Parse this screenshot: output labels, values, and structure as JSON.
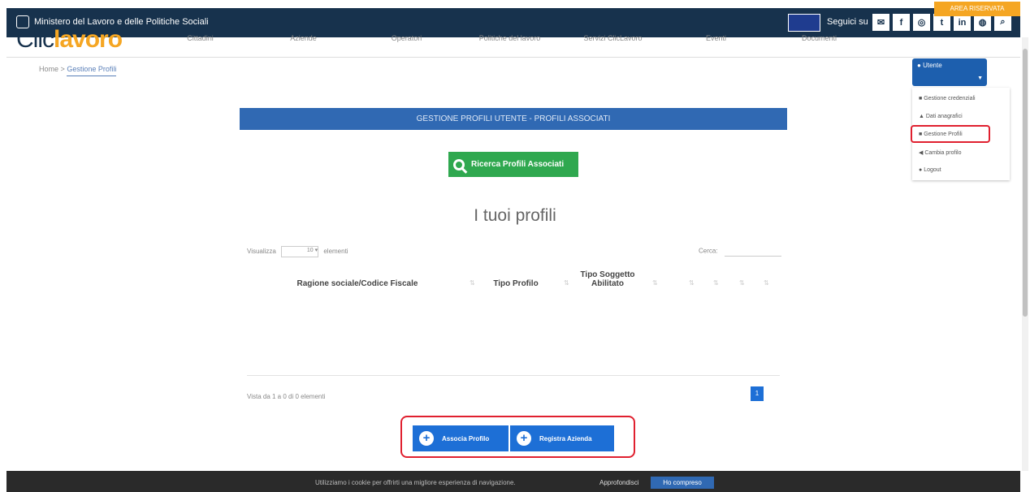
{
  "topbar": {
    "ministry": "Ministero del Lavoro e delle Politiche Sociali",
    "seguici": "Seguici su",
    "socials": [
      {
        "icon": "email-icon",
        "glyph": "✉"
      },
      {
        "icon": "facebook-icon",
        "glyph": "f"
      },
      {
        "icon": "instagram-icon",
        "glyph": "◎"
      },
      {
        "icon": "twitter-icon",
        "glyph": "t"
      },
      {
        "icon": "linkedin-icon",
        "glyph": "in"
      },
      {
        "icon": "flickr-icon",
        "glyph": "◍"
      },
      {
        "icon": "search-icon",
        "glyph": "⌕"
      }
    ]
  },
  "header": {
    "logo_main": "Clic",
    "logo_accent": "lavoro",
    "nav": [
      "Cittadini",
      "Aziende",
      "Operatori",
      "Politiche del lavoro",
      "Servizi ClicLavoro",
      "Eventi",
      "Documenti"
    ],
    "area_riservata": "AREA RISERVATA"
  },
  "breadcrumb": {
    "home": "Home",
    "separator": ">",
    "current": "Gestione Profili"
  },
  "user": {
    "name": "Utente",
    "menu": [
      "Gestione credenziali",
      "Dati anagrafici",
      "Gestione Profili",
      "Cambia profilo",
      "Logout"
    ]
  },
  "main": {
    "title": "GESTIONE PROFILI UTENTE - PROFILI ASSOCIATI",
    "search_button": "Ricerca Profili Associati",
    "profiles_title": "I tuoi profili",
    "length_label": "Visualizza",
    "length_value": "10",
    "length_suffix": "elementi",
    "filter_label": "Cerca:",
    "columns": [
      "Ragione sociale/Codice Fiscale",
      "Tipo Profilo",
      "Tipo Soggetto Abilitato"
    ],
    "info": "Vista da 1 a 0 di 0 elementi",
    "page": "1",
    "add_profile_button": "Associa Profilo",
    "register_company_button": "Registra Azienda"
  },
  "cookie": {
    "text": "Utilizziamo i cookie per offrirti una migliore esperienza di navigazione.",
    "more": "Approfondisci",
    "accept": "Ho compreso"
  },
  "colors": {
    "topbar": "#17324d",
    "primary_blue": "#3069b3",
    "button_blue": "#1d6fd6",
    "green": "#2fa84f",
    "orange": "#f5a623",
    "highlight_red": "#e0202f"
  }
}
